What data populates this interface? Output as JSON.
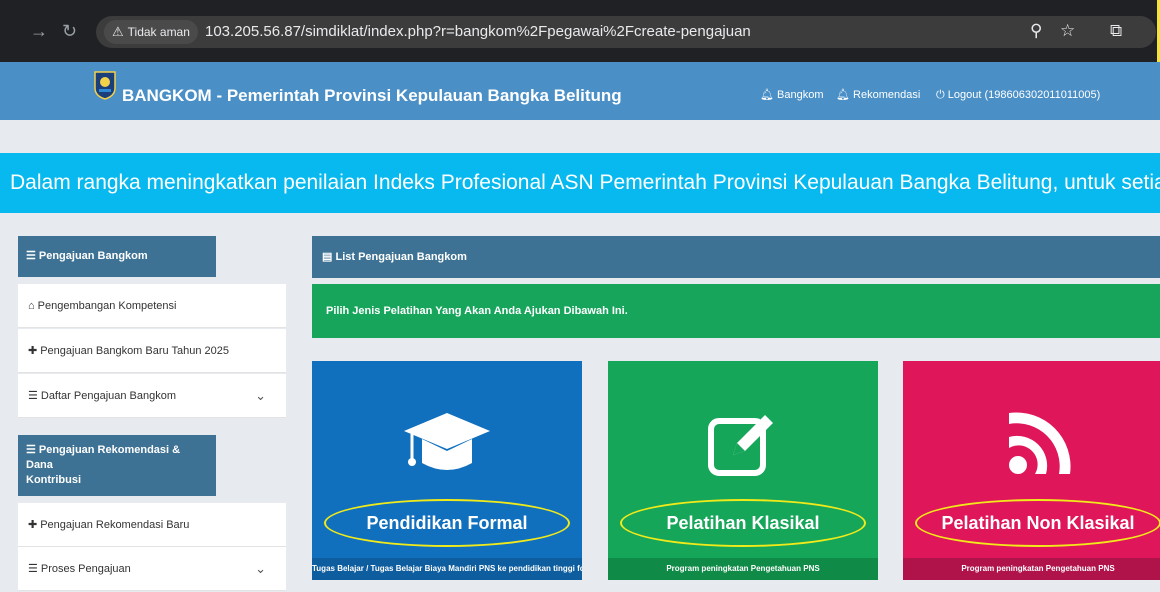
{
  "browser": {
    "security_label": "Tidak aman",
    "url": "103.205.56.87/simdiklat/index.php?r=bangkom%2Fpegawai%2Fcreate-pengajuan"
  },
  "header": {
    "brand": "BANGKOM - Pemerintah Provinsi Kepulauan Bangka Belitung",
    "links": [
      "Bangkom",
      "Rekomendasi",
      "Logout (198606302011011005)"
    ]
  },
  "banner": {
    "text": "Dalam rangka meningkatkan penilaian Indeks Profesional ASN Pemerintah Provinsi Kepulauan Bangka Belitung, untuk setiap kegiatan pengembangan kompe"
  },
  "sidebar": {
    "section1_title": "Pengajuan Bangkom",
    "section1_items": [
      "Pengembangan Kompetensi",
      "Pengajuan Bangkom Baru Tahun 2025",
      "Daftar Pengajuan Bangkom"
    ],
    "section2_title_line1": "Pengajuan Rekomendasi & Dana",
    "section2_title_line2": "Kontribusi",
    "section2_items": [
      "Pengajuan Rekomendasi Baru",
      "Proses Pengajuan"
    ]
  },
  "main": {
    "panel_title": "List Pengajuan Bangkom",
    "info_text": "Pilih Jenis Pelatihan Yang Akan Anda Ajukan Dibawah Ini.",
    "cards": [
      {
        "title": "Pendidikan Formal",
        "footer": "Tugas Belajar / Tugas Belajar Biaya Mandiri PNS ke pendidikan tinggi formal",
        "color": "#1170be",
        "footer_color": "#0d5d9f"
      },
      {
        "title": "Pelatihan Klasikal",
        "footer": "Program peningkatan Pengetahuan PNS",
        "color": "#16a659",
        "footer_color": "#0f8a47"
      },
      {
        "title": "Pelatihan Non Klasikal",
        "footer": "Program peningkatan Pengetahuan PNS",
        "color": "#e0165a",
        "footer_color": "#b0134a"
      }
    ]
  },
  "annotation_color": "#f0ea1a"
}
